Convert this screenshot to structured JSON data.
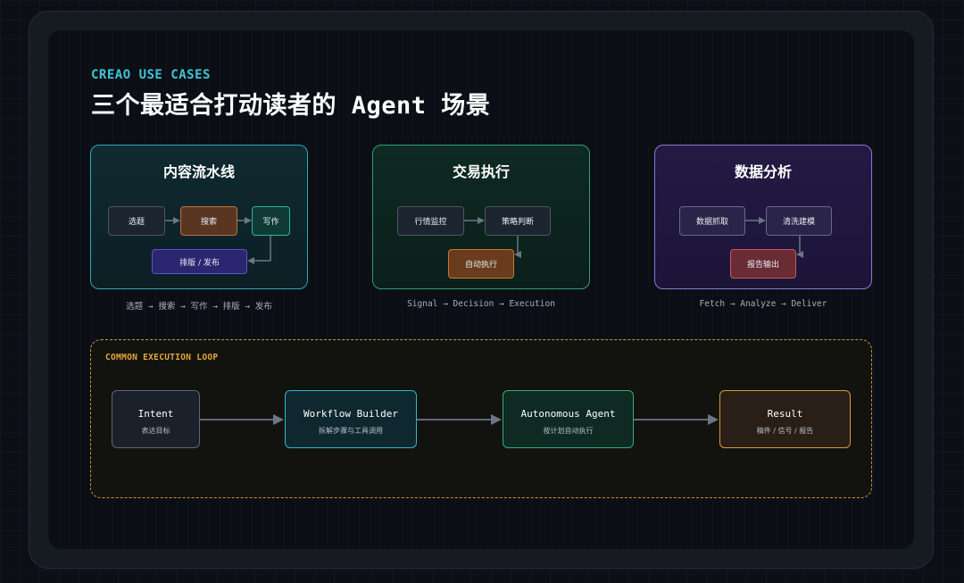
{
  "header": {
    "eyebrow": "CREAO USE CASES",
    "title": "三个最适合打动读者的 Agent 场景"
  },
  "cards": [
    {
      "title": "内容流水线",
      "nodes": [
        "选题",
        "搜索",
        "写作",
        "排版 / 发布"
      ],
      "caption": "选题 → 搜索 → 写作 → 排版 → 发布"
    },
    {
      "title": "交易执行",
      "nodes": [
        "行情监控",
        "策略判断",
        "自动执行"
      ],
      "caption": "Signal → Decision → Execution"
    },
    {
      "title": "数据分析",
      "nodes": [
        "数据抓取",
        "清洗建模",
        "报告输出"
      ],
      "caption": "Fetch → Analyze → Deliver"
    }
  ],
  "loop": {
    "label": "COMMON EXECUTION LOOP",
    "steps": [
      {
        "title": "Intent",
        "subtitle": "表达目标"
      },
      {
        "title": "Workflow Builder",
        "subtitle": "拆解步骤与工具调用"
      },
      {
        "title": "Autonomous Agent",
        "subtitle": "按计划自动执行"
      },
      {
        "title": "Result",
        "subtitle": "稿件 / 信号 / 报告"
      }
    ]
  },
  "colors": {
    "accent_cyan": "#3ec6d6",
    "accent_green": "#2f9e73",
    "accent_purple": "#8f76d6",
    "accent_amber": "#e2a63a",
    "arrow": "#6b7686"
  }
}
